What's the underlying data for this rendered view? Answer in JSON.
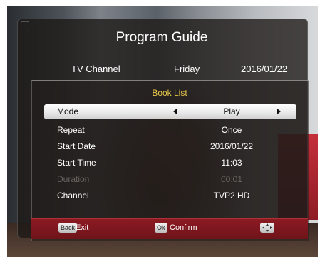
{
  "title": "Program Guide",
  "info": {
    "channel": "TV Channel",
    "day": "Friday",
    "date": "2016/01/22"
  },
  "book_list": {
    "title": "Book List",
    "rows": [
      {
        "label": "Mode",
        "value": "Play"
      },
      {
        "label": "Repeat",
        "value": "Once"
      },
      {
        "label": "Start Date",
        "value": "2016/01/22"
      },
      {
        "label": "Start Time",
        "value": "11:03"
      },
      {
        "label": "Duration",
        "value": "00:01"
      },
      {
        "label": "Channel",
        "value": "TVP2 HD"
      }
    ]
  },
  "footer": {
    "back_key": "Back",
    "back_label": "Exit",
    "ok_key": "Ok",
    "ok_label": "Confirm"
  }
}
